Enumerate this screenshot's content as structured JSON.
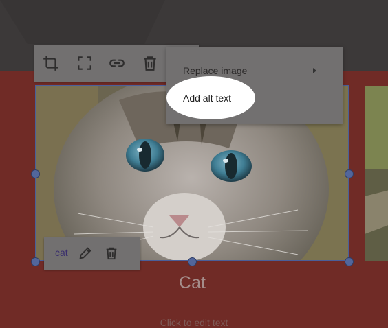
{
  "toolbar": {
    "buttons": [
      {
        "icon": "crop-icon"
      },
      {
        "icon": "fullscreen-icon"
      },
      {
        "icon": "link-icon"
      },
      {
        "icon": "trash-icon"
      }
    ]
  },
  "menu": {
    "items": [
      {
        "label": "Replace image",
        "has_submenu": true
      },
      {
        "label": "Add alt text",
        "highlighted": true
      }
    ]
  },
  "link_bar": {
    "link_text": "cat",
    "actions": [
      {
        "icon": "pencil-icon"
      },
      {
        "icon": "trash-icon"
      }
    ]
  },
  "image": {
    "caption": "Cat",
    "placeholder": "Click to edit text"
  },
  "colors": {
    "accent": "#52669b",
    "section_background": "#702b26",
    "header_background": "#3c3939"
  }
}
